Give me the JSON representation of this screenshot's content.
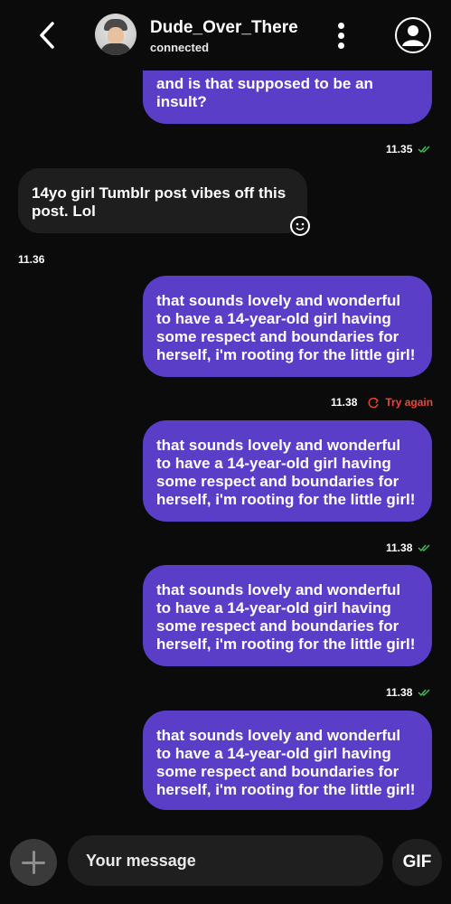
{
  "header": {
    "contact_name": "Dude_Over_There",
    "status": "connected",
    "back_icon": "chevron-left-icon",
    "menu_icon": "more-vertical-icon",
    "profile_icon": "user-circle-icon"
  },
  "messages": [
    {
      "direction": "out",
      "text": "and is that supposed to be an\ninsult?",
      "time": "11.35",
      "state": "delivered"
    },
    {
      "direction": "in",
      "text": "14yo girl Tumblr post vibes off this\npost. Lol",
      "time": "11.36",
      "reaction_icon": "smiley-icon"
    },
    {
      "direction": "out",
      "text": "that sounds lovely and wonderful\nto have a 14-year-old girl having\nsome respect and boundaries for\nherself, i'm rooting for the little girl!",
      "time": "11.38",
      "state": "failed",
      "retry_label": "Try again"
    },
    {
      "direction": "out",
      "text": "that sounds lovely and wonderful\nto have a 14-year-old girl having\nsome respect and boundaries for\nherself, i'm rooting for the little girl!",
      "time": "11.38",
      "state": "delivered"
    },
    {
      "direction": "out",
      "text": "that sounds lovely and wonderful\nto have a 14-year-old girl having\nsome respect and boundaries for\nherself, i'm rooting for the little girl!",
      "time": "11.38",
      "state": "delivered"
    },
    {
      "direction": "out",
      "text": "that sounds lovely and wonderful\nto have a 14-year-old girl having\nsome respect and boundaries for\nherself, i'm rooting for the little girl!",
      "time": "",
      "state": ""
    }
  ],
  "composer": {
    "placeholder": "Your message",
    "gif_label": "GIF",
    "add_icon": "plus-icon"
  },
  "colors": {
    "outgoing_bubble": "#5a3ec8",
    "incoming_bubble": "#1e1e1e",
    "background": "#0b0b0b",
    "error": "#e8473b",
    "checkmark": "#3fc25a"
  }
}
